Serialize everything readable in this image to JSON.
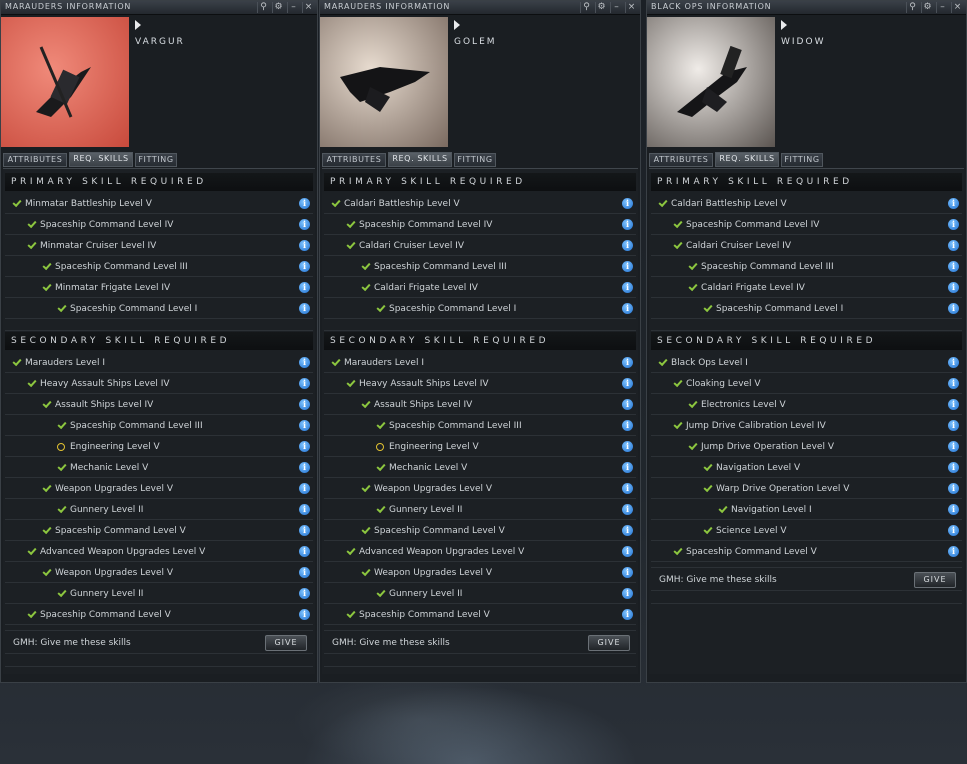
{
  "windows": [
    {
      "title": "MARAUDERS INFORMATION",
      "ship": "VARGUR",
      "portrait_colors": [
        "#f08a7a",
        "#c84a3c"
      ],
      "tabs": [
        "ATTRIBUTES",
        "REQ. SKILLS",
        "FITTING"
      ],
      "active_tab": 1,
      "primary_header": "PRIMARY SKILL REQUIRED",
      "primary": [
        {
          "label": "Minmatar Battleship Level V",
          "level": 0,
          "status": "check"
        },
        {
          "label": "Spaceship Command Level IV",
          "level": 1,
          "status": "check"
        },
        {
          "label": "Minmatar Cruiser Level IV",
          "level": 1,
          "status": "check"
        },
        {
          "label": "Spaceship Command Level III",
          "level": 2,
          "status": "check"
        },
        {
          "label": "Minmatar Frigate Level IV",
          "level": 2,
          "status": "check"
        },
        {
          "label": "Spaceship Command Level I",
          "level": 3,
          "status": "check"
        }
      ],
      "secondary_header": "SECONDARY SKILL REQUIRED",
      "secondary": [
        {
          "label": "Marauders Level I",
          "level": 0,
          "status": "check"
        },
        {
          "label": "Heavy Assault Ships Level IV",
          "level": 1,
          "status": "check"
        },
        {
          "label": "Assault Ships Level IV",
          "level": 2,
          "status": "check"
        },
        {
          "label": "Spaceship Command Level III",
          "level": 3,
          "status": "check"
        },
        {
          "label": "Engineering Level V",
          "level": 3,
          "status": "ring"
        },
        {
          "label": "Mechanic Level V",
          "level": 3,
          "status": "check"
        },
        {
          "label": "Weapon Upgrades Level V",
          "level": 2,
          "status": "check"
        },
        {
          "label": "Gunnery Level II",
          "level": 3,
          "status": "check"
        },
        {
          "label": "Spaceship Command Level V",
          "level": 2,
          "status": "check"
        },
        {
          "label": "Advanced Weapon Upgrades Level V",
          "level": 1,
          "status": "check"
        },
        {
          "label": "Weapon Upgrades Level V",
          "level": 2,
          "status": "check"
        },
        {
          "label": "Gunnery Level II",
          "level": 3,
          "status": "check"
        },
        {
          "label": "Spaceship Command Level V",
          "level": 1,
          "status": "check"
        }
      ],
      "gmh_text": "GMH: Give me these skills",
      "give_label": "GIVE"
    },
    {
      "title": "MARAUDERS INFORMATION",
      "ship": "GOLEM",
      "portrait_colors": [
        "#e8dcd0",
        "#7a6a60"
      ],
      "tabs": [
        "ATTRIBUTES",
        "REQ. SKILLS",
        "FITTING"
      ],
      "active_tab": 1,
      "primary_header": "PRIMARY SKILL REQUIRED",
      "primary": [
        {
          "label": "Caldari Battleship Level V",
          "level": 0,
          "status": "check"
        },
        {
          "label": "Spaceship Command Level IV",
          "level": 1,
          "status": "check"
        },
        {
          "label": "Caldari Cruiser Level IV",
          "level": 1,
          "status": "check"
        },
        {
          "label": "Spaceship Command Level III",
          "level": 2,
          "status": "check"
        },
        {
          "label": "Caldari Frigate Level IV",
          "level": 2,
          "status": "check"
        },
        {
          "label": "Spaceship Command Level I",
          "level": 3,
          "status": "check"
        }
      ],
      "secondary_header": "SECONDARY SKILL REQUIRED",
      "secondary": [
        {
          "label": "Marauders Level I",
          "level": 0,
          "status": "check"
        },
        {
          "label": "Heavy Assault Ships Level IV",
          "level": 1,
          "status": "check"
        },
        {
          "label": "Assault Ships Level IV",
          "level": 2,
          "status": "check"
        },
        {
          "label": "Spaceship Command Level III",
          "level": 3,
          "status": "check"
        },
        {
          "label": "Engineering Level V",
          "level": 3,
          "status": "ring"
        },
        {
          "label": "Mechanic Level V",
          "level": 3,
          "status": "check"
        },
        {
          "label": "Weapon Upgrades Level V",
          "level": 2,
          "status": "check"
        },
        {
          "label": "Gunnery Level II",
          "level": 3,
          "status": "check"
        },
        {
          "label": "Spaceship Command Level V",
          "level": 2,
          "status": "check"
        },
        {
          "label": "Advanced Weapon Upgrades Level V",
          "level": 1,
          "status": "check"
        },
        {
          "label": "Weapon Upgrades Level V",
          "level": 2,
          "status": "check"
        },
        {
          "label": "Gunnery Level II",
          "level": 3,
          "status": "check"
        },
        {
          "label": "Spaceship Command Level V",
          "level": 1,
          "status": "check"
        }
      ],
      "gmh_text": "GMH: Give me these skills",
      "give_label": "GIVE"
    },
    {
      "title": "BLACK OPS INFORMATION",
      "ship": "WIDOW",
      "portrait_colors": [
        "#f0ece8",
        "#5a5450"
      ],
      "tabs": [
        "ATTRIBUTES",
        "REQ. SKILLS",
        "FITTING"
      ],
      "active_tab": 1,
      "primary_header": "PRIMARY SKILL REQUIRED",
      "primary": [
        {
          "label": "Caldari Battleship Level V",
          "level": 0,
          "status": "check"
        },
        {
          "label": "Spaceship Command Level IV",
          "level": 1,
          "status": "check"
        },
        {
          "label": "Caldari Cruiser Level IV",
          "level": 1,
          "status": "check"
        },
        {
          "label": "Spaceship Command Level III",
          "level": 2,
          "status": "check"
        },
        {
          "label": "Caldari Frigate Level IV",
          "level": 2,
          "status": "check"
        },
        {
          "label": "Spaceship Command Level I",
          "level": 3,
          "status": "check"
        }
      ],
      "secondary_header": "SECONDARY SKILL REQUIRED",
      "secondary": [
        {
          "label": "Black Ops Level I",
          "level": 0,
          "status": "check"
        },
        {
          "label": "Cloaking Level V",
          "level": 1,
          "status": "check"
        },
        {
          "label": "Electronics Level V",
          "level": 2,
          "status": "check"
        },
        {
          "label": "Jump Drive Calibration Level IV",
          "level": 1,
          "status": "check"
        },
        {
          "label": "Jump Drive Operation Level V",
          "level": 2,
          "status": "check"
        },
        {
          "label": "Navigation Level V",
          "level": 3,
          "status": "check"
        },
        {
          "label": "Warp Drive Operation Level V",
          "level": 3,
          "status": "check"
        },
        {
          "label": "Navigation Level I",
          "level": 4,
          "status": "check"
        },
        {
          "label": "Science Level V",
          "level": 3,
          "status": "check"
        },
        {
          "label": "Spaceship Command Level V",
          "level": 1,
          "status": "check"
        }
      ],
      "gmh_text": "GMH: Give me these skills",
      "give_label": "GIVE"
    }
  ],
  "colors": {
    "check": "#8cc63f",
    "ring": "#e2c231",
    "info": "#2a85e6"
  },
  "icons": {
    "info": "info-icon",
    "settings": "gear-icon",
    "minimize": "minimize-icon",
    "close": "close-icon",
    "pin": "pin-icon"
  }
}
